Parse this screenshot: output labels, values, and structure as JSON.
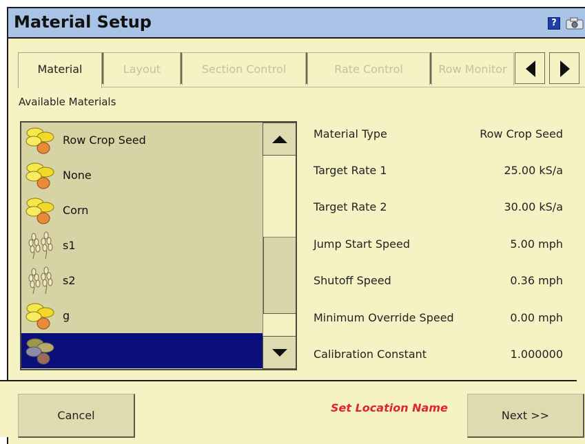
{
  "window": {
    "title": "Material Setup"
  },
  "title_icons": [
    "help-icon",
    "camera-icon"
  ],
  "tabs": [
    {
      "label": "Material",
      "active": true
    },
    {
      "label": "Layout",
      "active": false
    },
    {
      "label": "Section Control",
      "active": false
    },
    {
      "label": "Rate Control",
      "active": false
    },
    {
      "label": "Row Monitor",
      "active": false
    }
  ],
  "tab_nav": [
    "left-arrow-icon",
    "right-arrow-icon"
  ],
  "materials": {
    "label": "Available Materials",
    "items": [
      {
        "label": "Row Crop Seed",
        "icon": "seed-icon"
      },
      {
        "label": "None",
        "icon": "seed-icon"
      },
      {
        "label": "Corn",
        "icon": "seed-icon"
      },
      {
        "label": "s1",
        "icon": "wheat-icon"
      },
      {
        "label": "s2",
        "icon": "wheat-icon"
      },
      {
        "label": "g",
        "icon": "seed-icon"
      },
      {
        "label": "",
        "icon": "seed-icon",
        "selected": true
      }
    ]
  },
  "properties": [
    {
      "label": "Material Type",
      "value": "Row Crop Seed"
    },
    {
      "label": "Target Rate 1",
      "value": "25.00 kS/a"
    },
    {
      "label": "Target Rate 2",
      "value": "30.00 kS/a"
    },
    {
      "label": "Jump Start Speed",
      "value": "5.00 mph"
    },
    {
      "label": "Shutoff Speed",
      "value": "0.36 mph"
    },
    {
      "label": "Minimum Override Speed",
      "value": "0.00 mph"
    },
    {
      "label": "Calibration Constant",
      "value": "1.000000"
    }
  ],
  "footer": {
    "cancel": "Cancel",
    "location": "Set Location Name",
    "next": "Next >>"
  },
  "colors": {
    "panel": "#f5f2c4",
    "titlebar": "#a9c3e6",
    "selection": "#0a0f7a",
    "alert": "#e0262a"
  }
}
